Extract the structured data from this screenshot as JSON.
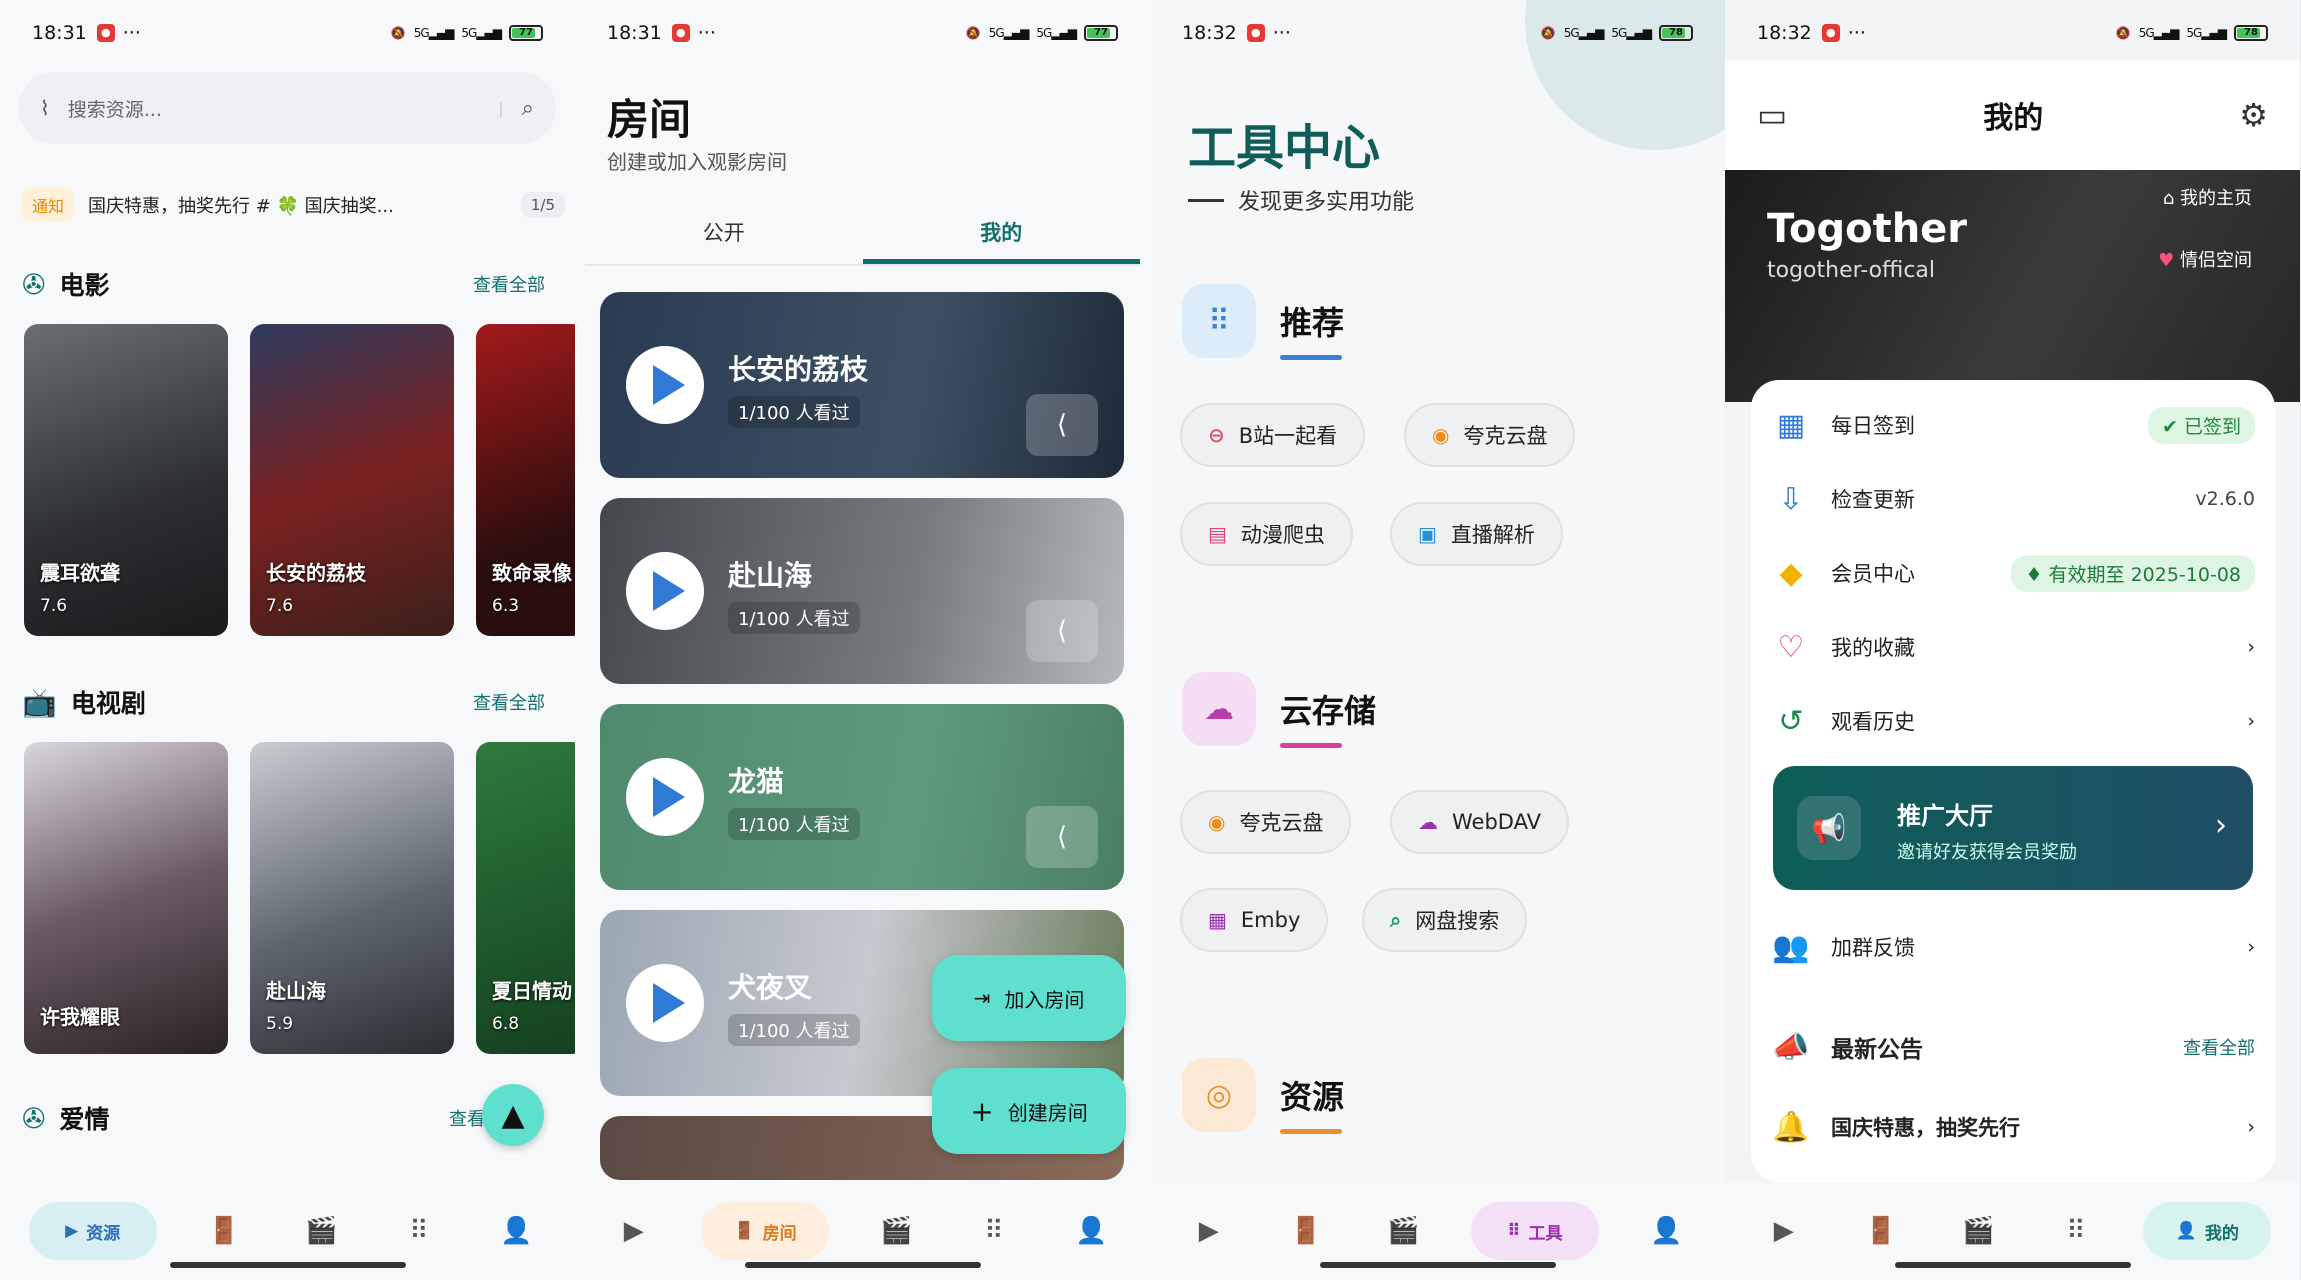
{
  "s1": {
    "status": {
      "time": "18:31",
      "battery": "77"
    },
    "search_placeholder": "搜索资源...",
    "notice": {
      "tag": "通知",
      "text": "国庆特惠，抽奖先行 # 🍀 国庆抽奖...",
      "counter": "1/5"
    },
    "sections": [
      {
        "title": "电影",
        "more": "查看全部"
      },
      {
        "title": "电视剧",
        "more": "查看全部"
      },
      {
        "title": "爱情",
        "more": "查看"
      }
    ],
    "movies": [
      {
        "name": "震耳欲聋",
        "score": "7.6"
      },
      {
        "name": "长安的荔枝",
        "score": "7.6"
      },
      {
        "name": "致命录像",
        "score": "6.3"
      }
    ],
    "tv": [
      {
        "name": "许我耀眼",
        "score": ""
      },
      {
        "name": "赴山海",
        "score": "5.9"
      },
      {
        "name": "夏日情动",
        "score": "6.8"
      }
    ],
    "nav_active": "资源"
  },
  "s2": {
    "status": {
      "time": "18:31",
      "battery": "77"
    },
    "title": "房间",
    "subtitle": "创建或加入观影房间",
    "tabs": [
      "公开",
      "我的"
    ],
    "rooms": [
      {
        "name": "长安的荔枝",
        "count": "1/100 人看过"
      },
      {
        "name": "赴山海",
        "count": "1/100 人看过"
      },
      {
        "name": "龙猫",
        "count": "1/100 人看过"
      },
      {
        "name": "犬夜叉",
        "count": "1/100 人看过"
      }
    ],
    "join": "加入房间",
    "create": "创建房间",
    "nav_active": "房间"
  },
  "s3": {
    "status": {
      "time": "18:32",
      "battery": "78"
    },
    "title": "工具中心",
    "subtitle": "发现更多实用功能",
    "groups": [
      {
        "title": "推荐",
        "chips": [
          "B站一起看",
          "夸克云盘",
          "动漫爬虫",
          "直播解析"
        ]
      },
      {
        "title": "云存储",
        "chips": [
          "夸克云盘",
          "WebDAV",
          "Emby",
          "网盘搜索"
        ]
      },
      {
        "title": "资源",
        "chips": []
      }
    ],
    "nav_active": "工具"
  },
  "s4": {
    "status": {
      "time": "18:32",
      "battery": "78"
    },
    "title": "我的",
    "user": {
      "name": "Togother",
      "id": "togother-offical",
      "home": "我的主页",
      "couple": "情侣空间"
    },
    "rows": [
      {
        "label": "每日签到",
        "right": "已签到"
      },
      {
        "label": "检查更新",
        "right": "v2.6.0"
      },
      {
        "label": "会员中心",
        "right": "有效期至 2025-10-08"
      },
      {
        "label": "我的收藏",
        "right": ""
      },
      {
        "label": "观看历史",
        "right": ""
      }
    ],
    "promo": {
      "title": "推广大厅",
      "sub": "邀请好友获得会员奖励"
    },
    "feedback": "加群反馈",
    "announce": {
      "title": "最新公告",
      "more": "查看全部",
      "item": "国庆特惠，抽奖先行"
    },
    "nav_active": "我的"
  },
  "colors": {
    "accent": "#14706d",
    "fab": "#5fe0cf"
  }
}
